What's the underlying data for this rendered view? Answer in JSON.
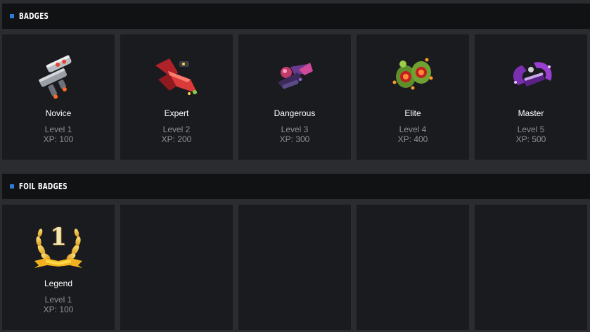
{
  "badges_section": {
    "title": "BADGES",
    "items": [
      {
        "name": "Novice",
        "level": "Level 1",
        "xp": "XP: 100",
        "icon": "grey-spaceship-icon"
      },
      {
        "name": "Expert",
        "level": "Level 2",
        "xp": "XP: 200",
        "icon": "red-spaceship-icon"
      },
      {
        "name": "Dangerous",
        "level": "Level 3",
        "xp": "XP: 300",
        "icon": "purple-spaceship-icon"
      },
      {
        "name": "Elite",
        "level": "Level 4",
        "xp": "XP: 400",
        "icon": "green-spaceship-icon"
      },
      {
        "name": "Master",
        "level": "Level 5",
        "xp": "XP: 500",
        "icon": "violet-spaceship-icon"
      }
    ]
  },
  "foil_section": {
    "title": "FOIL BADGES",
    "items": [
      {
        "name": "Legend",
        "level": "Level 1",
        "xp": "XP: 100",
        "icon": "gold-laurel-number-one-icon",
        "emblem_number": "1"
      }
    ],
    "empty_slots": 4
  },
  "colors": {
    "page_background": "#2a2c30",
    "header_background": "#111214",
    "card_background": "#1a1b1e",
    "accent": "#2f7ad9",
    "muted_text": "#8c8f95"
  }
}
